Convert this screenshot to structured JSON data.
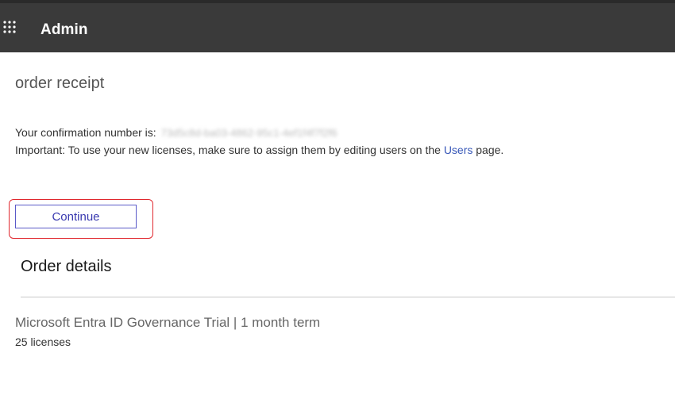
{
  "header": {
    "title": "Admin",
    "waffle_icon": "app-launcher-icon",
    "background_color": "#3a3a3a"
  },
  "main": {
    "page_title": "order receipt",
    "confirmation_label": "Your confirmation number is:",
    "confirmation_number": "73d5c8d-ba03-4862-95c1-4ef1f4f7f2f6",
    "important_prefix": "Important: To use your new licenses, make sure to assign them by editing users on the",
    "users_link": "Users",
    "important_suffix": "page.",
    "continue_label": "Continue",
    "highlight_color": "#e0282e",
    "link_color": "#3858b8"
  },
  "order_details": {
    "title": "Order details",
    "items": [
      {
        "product": "Microsoft Entra ID Governance Trial | 1 month term",
        "licenses": "25 licenses"
      }
    ]
  }
}
